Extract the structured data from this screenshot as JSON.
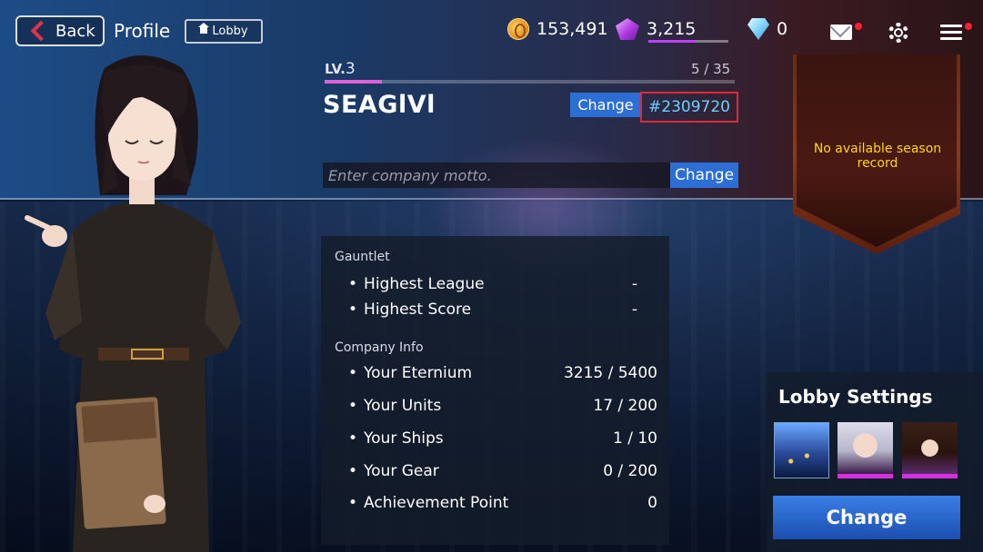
{
  "header": {
    "back_label": "Back",
    "title": "Profile",
    "lobby_label": "Lobby"
  },
  "currencies": {
    "gold": "153,491",
    "eternium": "3,215",
    "eternium_fill_fraction": 0.59,
    "diamonds": "0"
  },
  "profile": {
    "level_prefix": "LV.",
    "level": "3",
    "exp": "5 / 35",
    "exp_fraction": 0.14,
    "name": "SEAGlVl",
    "change_name_label": "Change",
    "id": "#2309720",
    "motto_placeholder": "Enter company motto.",
    "change_motto_label": "Change"
  },
  "season": {
    "text": "No available season record"
  },
  "stats": {
    "gauntlet_title": "Gauntlet",
    "gauntlet": [
      {
        "label": "Highest League",
        "value": "-"
      },
      {
        "label": "Highest Score",
        "value": "-"
      }
    ],
    "company_title": "Company Info",
    "company": [
      {
        "label": "Your Eternium",
        "value": "3215 / 5400"
      },
      {
        "label": "Your Units",
        "value": "17 / 200"
      },
      {
        "label": "Your Ships",
        "value": "1 / 10"
      },
      {
        "label": "Your Gear",
        "value": "0 / 200"
      },
      {
        "label": "Achievement Point",
        "value": "0"
      }
    ]
  },
  "lobby_settings": {
    "title": "Lobby Settings",
    "change_label": "Change"
  },
  "colors": {
    "accent_blue": "#2c6ed4",
    "highlight_red": "#e02a3a",
    "id_cyan": "#6fd0ff",
    "gold_text": "#ffd700",
    "exp_pink": "#e060d8"
  }
}
